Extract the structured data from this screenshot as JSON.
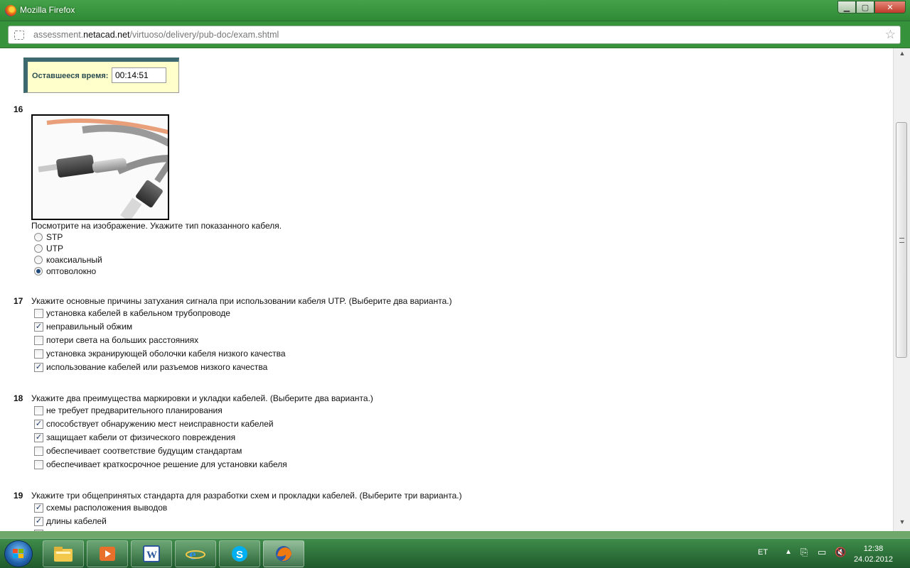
{
  "window": {
    "title": "Mozilla Firefox"
  },
  "urlbar": {
    "url_prefix": "assessment.",
    "url_domain": "netacad.net",
    "url_path": "/virtuoso/delivery/pub-doc/exam.shtml"
  },
  "timer": {
    "label": "Оставшееся время:",
    "value": "00:14:51"
  },
  "questions": [
    {
      "number": "16",
      "text": "Посмотрите на изображение. Укажите тип показанного кабеля.",
      "kind": "radio",
      "options": [
        {
          "label": "STP",
          "checked": false
        },
        {
          "label": "UTP",
          "checked": false
        },
        {
          "label": "коаксиальный",
          "checked": false
        },
        {
          "label": "оптоволокно",
          "checked": true
        }
      ]
    },
    {
      "number": "17",
      "text": "Укажите основные причины затухания сигнала при использовании кабеля UTP. (Выберите два варианта.)",
      "kind": "checkbox",
      "options": [
        {
          "label": "установка кабелей в кабельном трубопроводе",
          "checked": false
        },
        {
          "label": "неправильный обжим",
          "checked": true
        },
        {
          "label": "потери света на больших расстояниях",
          "checked": false
        },
        {
          "label": "установка экранирующей оболочки кабеля низкого качества",
          "checked": false
        },
        {
          "label": "использование кабелей или разъемов низкого качества",
          "checked": true
        }
      ]
    },
    {
      "number": "18",
      "text": "Укажите два преимущества маркировки и укладки кабелей. (Выберите два варианта.)",
      "kind": "checkbox",
      "options": [
        {
          "label": "не требует предварительного планирования",
          "checked": false
        },
        {
          "label": "способствует обнаружению мест неисправности кабелей",
          "checked": true
        },
        {
          "label": "защищает кабели от физического повреждения",
          "checked": true
        },
        {
          "label": "обеспечивает соответствие будущим стандартам",
          "checked": false
        },
        {
          "label": "обеспечивает краткосрочное решение для установки кабеля",
          "checked": false
        }
      ]
    },
    {
      "number": "19",
      "text": "Укажите три общепринятых стандарта для разработки схем и прокладки кабелей. (Выберите три варианта.)",
      "kind": "checkbox",
      "options": [
        {
          "label": "схемы расположения выводов",
          "checked": true
        },
        {
          "label": "длины кабелей",
          "checked": true
        }
      ]
    }
  ],
  "taskbar": {
    "apps": [
      {
        "name": "explorer",
        "icon": "folder-icon"
      },
      {
        "name": "media-player",
        "icon": "media-icon"
      },
      {
        "name": "word",
        "icon": "word-icon"
      },
      {
        "name": "internet-explorer",
        "icon": "ie-icon"
      },
      {
        "name": "skype",
        "icon": "skype-icon"
      },
      {
        "name": "firefox",
        "icon": "firefox-icon",
        "active": true
      }
    ],
    "language": "ET",
    "time": "12:38",
    "date": "24.02.2012"
  },
  "colors": {
    "window_green": "#36923b",
    "timer_bg": "#ffffcc",
    "timer_border": "#3d6a6e"
  }
}
